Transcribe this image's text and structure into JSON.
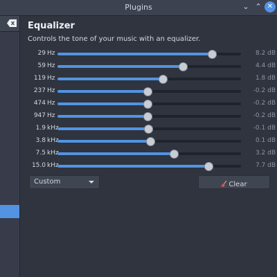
{
  "window": {
    "title": "Plugins"
  },
  "equalizer": {
    "heading": "Equalizer",
    "description": "Controls the tone of your music with an equalizer.",
    "min_db": -12,
    "max_db": 12,
    "accent_color": "#5294e2",
    "bands": [
      {
        "freq": "29",
        "unit": "Hz",
        "value": "8.2 dB",
        "db": 8.2
      },
      {
        "freq": "59",
        "unit": "Hz",
        "value": "4.4 dB",
        "db": 4.4
      },
      {
        "freq": "119",
        "unit": "Hz",
        "value": "1.8 dB",
        "db": 1.8
      },
      {
        "freq": "237",
        "unit": "Hz",
        "value": "-0.2 dB",
        "db": -0.2
      },
      {
        "freq": "474",
        "unit": "Hz",
        "value": "-0.2 dB",
        "db": -0.2
      },
      {
        "freq": "947",
        "unit": "Hz",
        "value": "-0.2 dB",
        "db": -0.2
      },
      {
        "freq": "1.9",
        "unit": "kHz",
        "value": "-0.1 dB",
        "db": -0.1
      },
      {
        "freq": "3.8",
        "unit": "kHz",
        "value": "0.1 dB",
        "db": 0.1
      },
      {
        "freq": "7.5",
        "unit": "kHz",
        "value": "3.2 dB",
        "db": 3.2
      },
      {
        "freq": "15.0",
        "unit": "kHz",
        "value": "7.7 dB",
        "db": 7.7
      }
    ],
    "preset": "Custom",
    "clear_label": "Clear"
  },
  "icons": {
    "minimize": "chevron-down-icon",
    "maximize": "chevron-up-icon",
    "close": "close-icon",
    "clear_search": "backspace-icon",
    "clear_button": "broom-icon"
  }
}
